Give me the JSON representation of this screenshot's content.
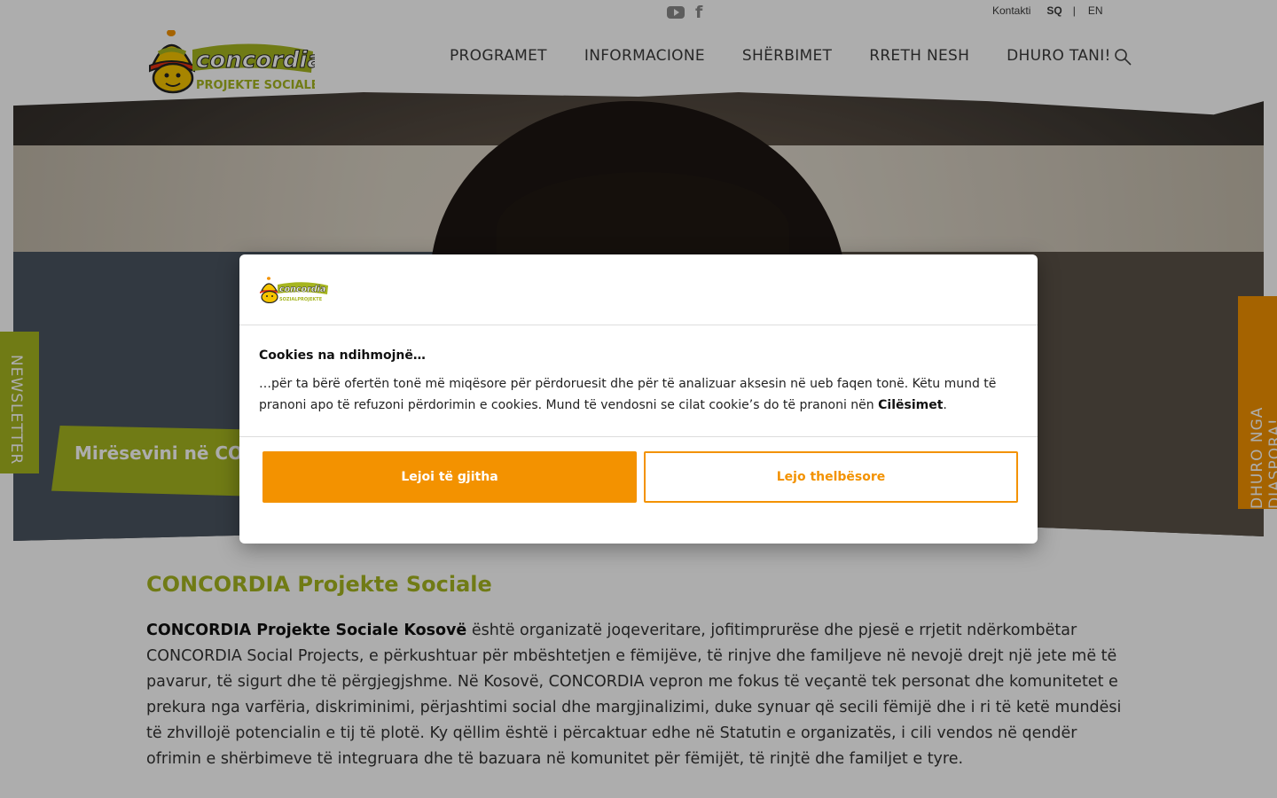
{
  "utility": {
    "contact": "Kontakti",
    "lang_sq": "SQ",
    "separator": "|",
    "lang_en": "EN"
  },
  "social": {
    "icons": [
      "youtube-icon",
      "facebook-icon"
    ],
    "facebook_glyph": "f"
  },
  "brand": {
    "name": "concordia",
    "tagline": "PROJEKTE SOCIALE",
    "green": "#a6b51f",
    "orange": "#f39200"
  },
  "nav": {
    "items": [
      "PROGRAMET",
      "INFORMACIONE",
      "SHËRBIMET",
      "RRETH NESH",
      "DHURO TANI!"
    ]
  },
  "hero": {
    "welcome": "Mirësevini në CONCORDIA"
  },
  "side_tabs": {
    "newsletter": "NEWSLETTER",
    "diaspora": "DHURO NGA DIASPORA!"
  },
  "content": {
    "heading": "CONCORDIA Projekte Sociale",
    "p1_strong": "CONCORDIA Projekte Sociale Kosovë",
    "p1_rest": " është organizatë joqeveritare, jofitimprurëse dhe pjesë e rrjetit ndërkombëtar CONCORDIA Social Projects, e përkushtuar për mbështetjen e fëmijëve, të rinjve dhe familjeve në nevojë drejt një jete më të pavarur, të sigurt dhe të përgjegjshme. Në Kosovë, CONCORDIA vepron me fokus të veçantë tek personat dhe komunitetet e prekura nga varfëria, diskriminimi, përjashtimi social dhe margjinalizimi, duke synuar që secili fëmijë dhe i ri të ketë mundësi të zhvillojë potencialin e tij të plotë. Ky qëllim është i përcaktuar edhe në Statutin e organizatës, i cili vendos në qendër ofrimin e shërbimeve të integruara dhe të bazuara në komunitet për fëmijët, të rinjtë dhe familjet e tyre."
  },
  "cookie_dialog": {
    "logo_name": "concordia",
    "logo_tagline": "SOZIALPROJEKTE",
    "title": "Cookies na ndihmojnë…",
    "text": "…për ta bërë ofertën tonë më miqësore për përdoruesit dhe për të analizuar aksesin në ueb faqen tonë. Këtu mund të pranoni apo të refuzoni përdorimin e cookies. Mund të vendosni se cilat cookie’s do të pranoni nën ",
    "settings_link": "Cilësimet",
    "text_end": ".",
    "accept_all": "Lejoi të gjitha",
    "accept_essential": "Lejo thelbësore"
  }
}
